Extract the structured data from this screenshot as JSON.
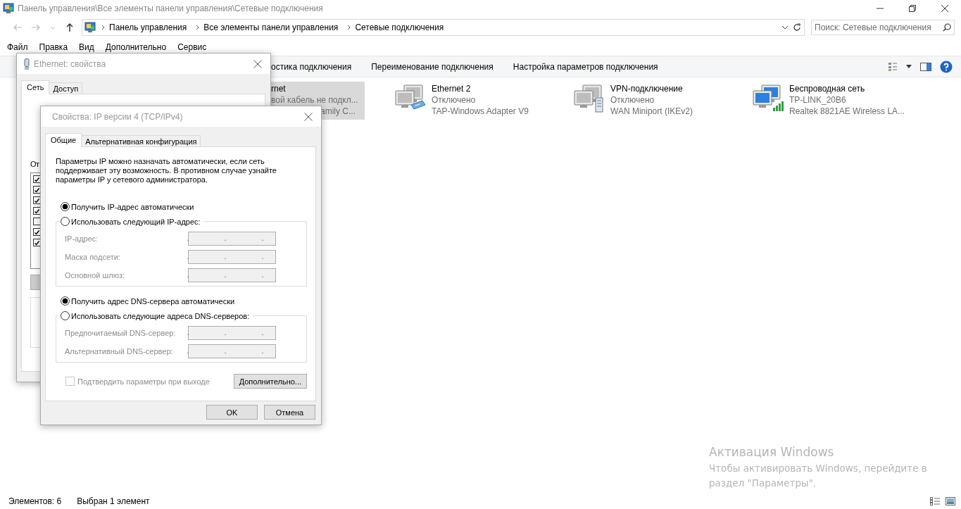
{
  "window": {
    "title": "Панель управления\\Все элементы панели управления\\Сетевые подключения"
  },
  "address_bar": {
    "path": [
      "Панель управления",
      "Все элементы панели управления",
      "Сетевые подключения"
    ]
  },
  "search": {
    "placeholder": "Поиск: Сетевые подключения"
  },
  "menu": [
    "Файл",
    "Правка",
    "Вид",
    "Дополнительно",
    "Сервис"
  ],
  "toolbar": {
    "items": [
      "остика подключения",
      "Переименование подключения",
      "Настройка параметров подключения"
    ]
  },
  "connections": [
    {
      "kind": "partial",
      "name": "rnet",
      "status": "вой кабель не подкл...",
      "device": "amily C...",
      "selected": true
    },
    {
      "kind": "adapter",
      "name": "Ethernet 2",
      "status": "Отключено",
      "device": "TAP-Windows Adapter V9",
      "selected": false
    },
    {
      "kind": "vpn",
      "name": "VPN-подключение",
      "status": "Отключено",
      "device": "WAN Miniport (IKEv2)",
      "selected": false
    },
    {
      "kind": "wireless",
      "name": "Беспроводная сеть",
      "status": "TP-LINK_20B6",
      "device": "Realtek 8821AE Wireless LA...",
      "selected": false
    }
  ],
  "status_bar": {
    "count": "Элементов: 6",
    "selection": "Выбран 1 элемент"
  },
  "activation": {
    "title": "Активация Windows",
    "lines": [
      "Чтобы активировать Windows, перейдите в",
      "раздел \"Параметры\"."
    ]
  },
  "ethernet_dialog": {
    "title": "Ethernet: свойства",
    "tabs": [
      {
        "label": "Сеть",
        "selected": true
      },
      {
        "label": "Доступ",
        "selected": false
      }
    ],
    "components_label": "От",
    "components": [
      {
        "checked": true
      },
      {
        "checked": true
      },
      {
        "checked": true
      },
      {
        "checked": true
      },
      {
        "checked": false
      },
      {
        "checked": true
      },
      {
        "checked": true
      }
    ]
  },
  "ipv4_dialog": {
    "title": "Свойства: IP версии 4 (TCP/IPv4)",
    "tabs": [
      {
        "label": "Общие",
        "selected": true
      },
      {
        "label": "Альтернативная конфигурация",
        "selected": false
      }
    ],
    "description": "Параметры IP можно назначать автоматически, если сеть поддерживает эту возможность. В противном случае узнайте параметры IP у сетевого администратора.",
    "ip_options": [
      {
        "label": "Получить IP-адрес автоматически",
        "selected": true
      },
      {
        "label": "Использовать следующий IP-адрес:",
        "selected": false
      }
    ],
    "ip_fields": [
      {
        "label": "IP-адрес:",
        "disabled": true,
        "separators": [
          ".",
          ".",
          "."
        ]
      },
      {
        "label": "Маска подсети:",
        "disabled": true,
        "separators": [
          ".",
          ".",
          "."
        ]
      },
      {
        "label": "Основной шлюз:",
        "disabled": true,
        "separators": [
          ".",
          ".",
          "."
        ]
      }
    ],
    "dns_options": [
      {
        "label": "Получить адрес DNS-сервера автоматически",
        "selected": true
      },
      {
        "label": "Использовать следующие адреса DNS-серверов:",
        "selected": false
      }
    ],
    "dns_fields": [
      {
        "label": "Предпочитаемый DNS-сервер:",
        "disabled": true,
        "separators": [
          ".",
          ".",
          "."
        ]
      },
      {
        "label": "Альтернативный DNS-сервер:",
        "disabled": true,
        "separators": [
          ".",
          ".",
          "."
        ]
      }
    ],
    "confirm": {
      "label": "Подтвердить параметры при выходе",
      "checked": false,
      "disabled": true
    },
    "advanced_button": "Дополнительно...",
    "buttons": [
      "OK",
      "Отмена"
    ]
  }
}
